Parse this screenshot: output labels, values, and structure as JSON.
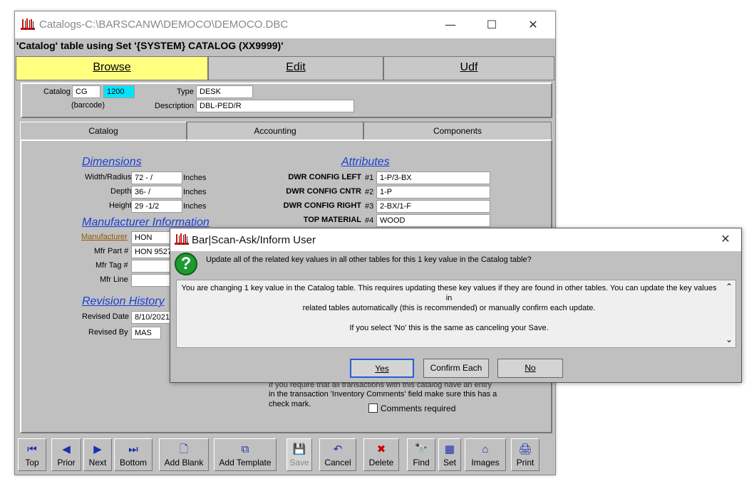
{
  "window": {
    "title": "Catalogs-C:\\BARSCANW\\DEMOCO\\DEMOCO.DBC",
    "minimize": "—",
    "maximize": "☐",
    "close": "✕"
  },
  "caption": "'Catalog' table using Set '{SYSTEM} CATALOG (XX9999)'",
  "top_tabs": [
    {
      "label": "Browse",
      "active": true
    },
    {
      "label": "Edit",
      "active": false
    },
    {
      "label": "Udf",
      "active": false
    }
  ],
  "header": {
    "catalog_label": "Catalog",
    "catalog_prefix": "CG",
    "catalog_number": "1200",
    "barcode_label": "(barcode)",
    "type_label": "Type",
    "type_value": "DESK",
    "description_label": "Description",
    "description_value": "DBL-PED/R"
  },
  "sub_tabs": [
    {
      "label": "Catalog",
      "active": true
    },
    {
      "label": "Accounting",
      "active": false
    },
    {
      "label": "Components",
      "active": false
    }
  ],
  "dimensions": {
    "title": "Dimensions",
    "width_label": "Width/Radius",
    "width_value": "72 - /",
    "width_unit": "Inches",
    "depth_label": "Depth",
    "depth_value": "36- /",
    "depth_unit": "Inches",
    "height_label": "Height",
    "height_value": "29 -1/2",
    "height_unit": "Inches"
  },
  "manufacturer": {
    "title": "Manufacturer Information",
    "manufacturer_label": "Manufacturer",
    "manufacturer_value": "HON",
    "part_label": "Mfr Part #",
    "part_value": "HON 95271",
    "tag_label": "Mfr Tag #",
    "tag_value": "",
    "line_label": "Mfr Line",
    "line_value": ""
  },
  "revision": {
    "title": "Revision History",
    "date_label": "Revised Date",
    "date_value": "8/10/2021",
    "by_label": "Revised By",
    "by_value": "MAS"
  },
  "attributes": {
    "title": "Attributes",
    "items": [
      {
        "label": "DWR CONFIG LEFT",
        "num": "#1",
        "value": "1-P/3-BX"
      },
      {
        "label": "DWR CONFIG CNTR",
        "num": "#2",
        "value": "1-P"
      },
      {
        "label": "DWR CONFIG RIGHT",
        "num": "#3",
        "value": "2-BX/1-F"
      },
      {
        "label": "TOP MATERIAL",
        "num": "#4",
        "value": "WOOD"
      }
    ]
  },
  "comments": {
    "note_line1": "If you require that all transactions with this catalog have an entry",
    "note_line2": "in the transaction 'Inventory Comments' field make sure this has a",
    "note_line3": "check mark.",
    "checkbox_label": "Comments required",
    "checked": false
  },
  "toolbar": [
    {
      "label": "Top",
      "icon": "first-icon",
      "glyph": "⏮"
    },
    {
      "label": "Prior",
      "icon": "prior-icon",
      "glyph": "◀"
    },
    {
      "label": "Next",
      "icon": "next-icon",
      "glyph": "▶"
    },
    {
      "label": "Bottom",
      "icon": "last-icon",
      "glyph": "⏭"
    },
    {
      "label": "Add Blank",
      "icon": "blank-page-icon",
      "glyph": "🗋"
    },
    {
      "label": "Add Template",
      "icon": "template-icon",
      "glyph": "⧉"
    },
    {
      "label": "Save",
      "icon": "save-icon",
      "glyph": "💾"
    },
    {
      "label": "Cancel",
      "icon": "undo-icon",
      "glyph": "↶"
    },
    {
      "label": "Delete",
      "icon": "delete-icon",
      "glyph": "✖"
    },
    {
      "label": "Find",
      "icon": "binoculars-icon",
      "glyph": "🔭"
    },
    {
      "label": "Set",
      "icon": "set-icon",
      "glyph": "▦"
    },
    {
      "label": "Images",
      "icon": "images-icon",
      "glyph": "⌂"
    },
    {
      "label": "Print",
      "icon": "print-icon",
      "glyph": "🖨"
    }
  ],
  "dialog": {
    "title": "Bar|Scan-Ask/Inform User",
    "close": "✕",
    "question": "Update all of the related key values in all other tables for this 1 key value in the Catalog table?",
    "message_line1": "You are changing 1 key value in the Catalog table. This requires updating these key values if they are found in other tables. You can update the key values in",
    "message_line2": "related tables automatically (this is recommended) or manually confirm each update.",
    "message_line3": "If you select 'No' this is the same as canceling your Save.",
    "yes_label": "Yes",
    "confirm_label": "Confirm Each",
    "no_label": "No",
    "help_glyph": "?"
  },
  "colors": {
    "active_tab": "#ffff80",
    "catalog_number_bg": "#00e5ff",
    "section_title": "#1a3fd1",
    "help_icon": "#1f9a30",
    "delete_icon": "#cc0000"
  }
}
